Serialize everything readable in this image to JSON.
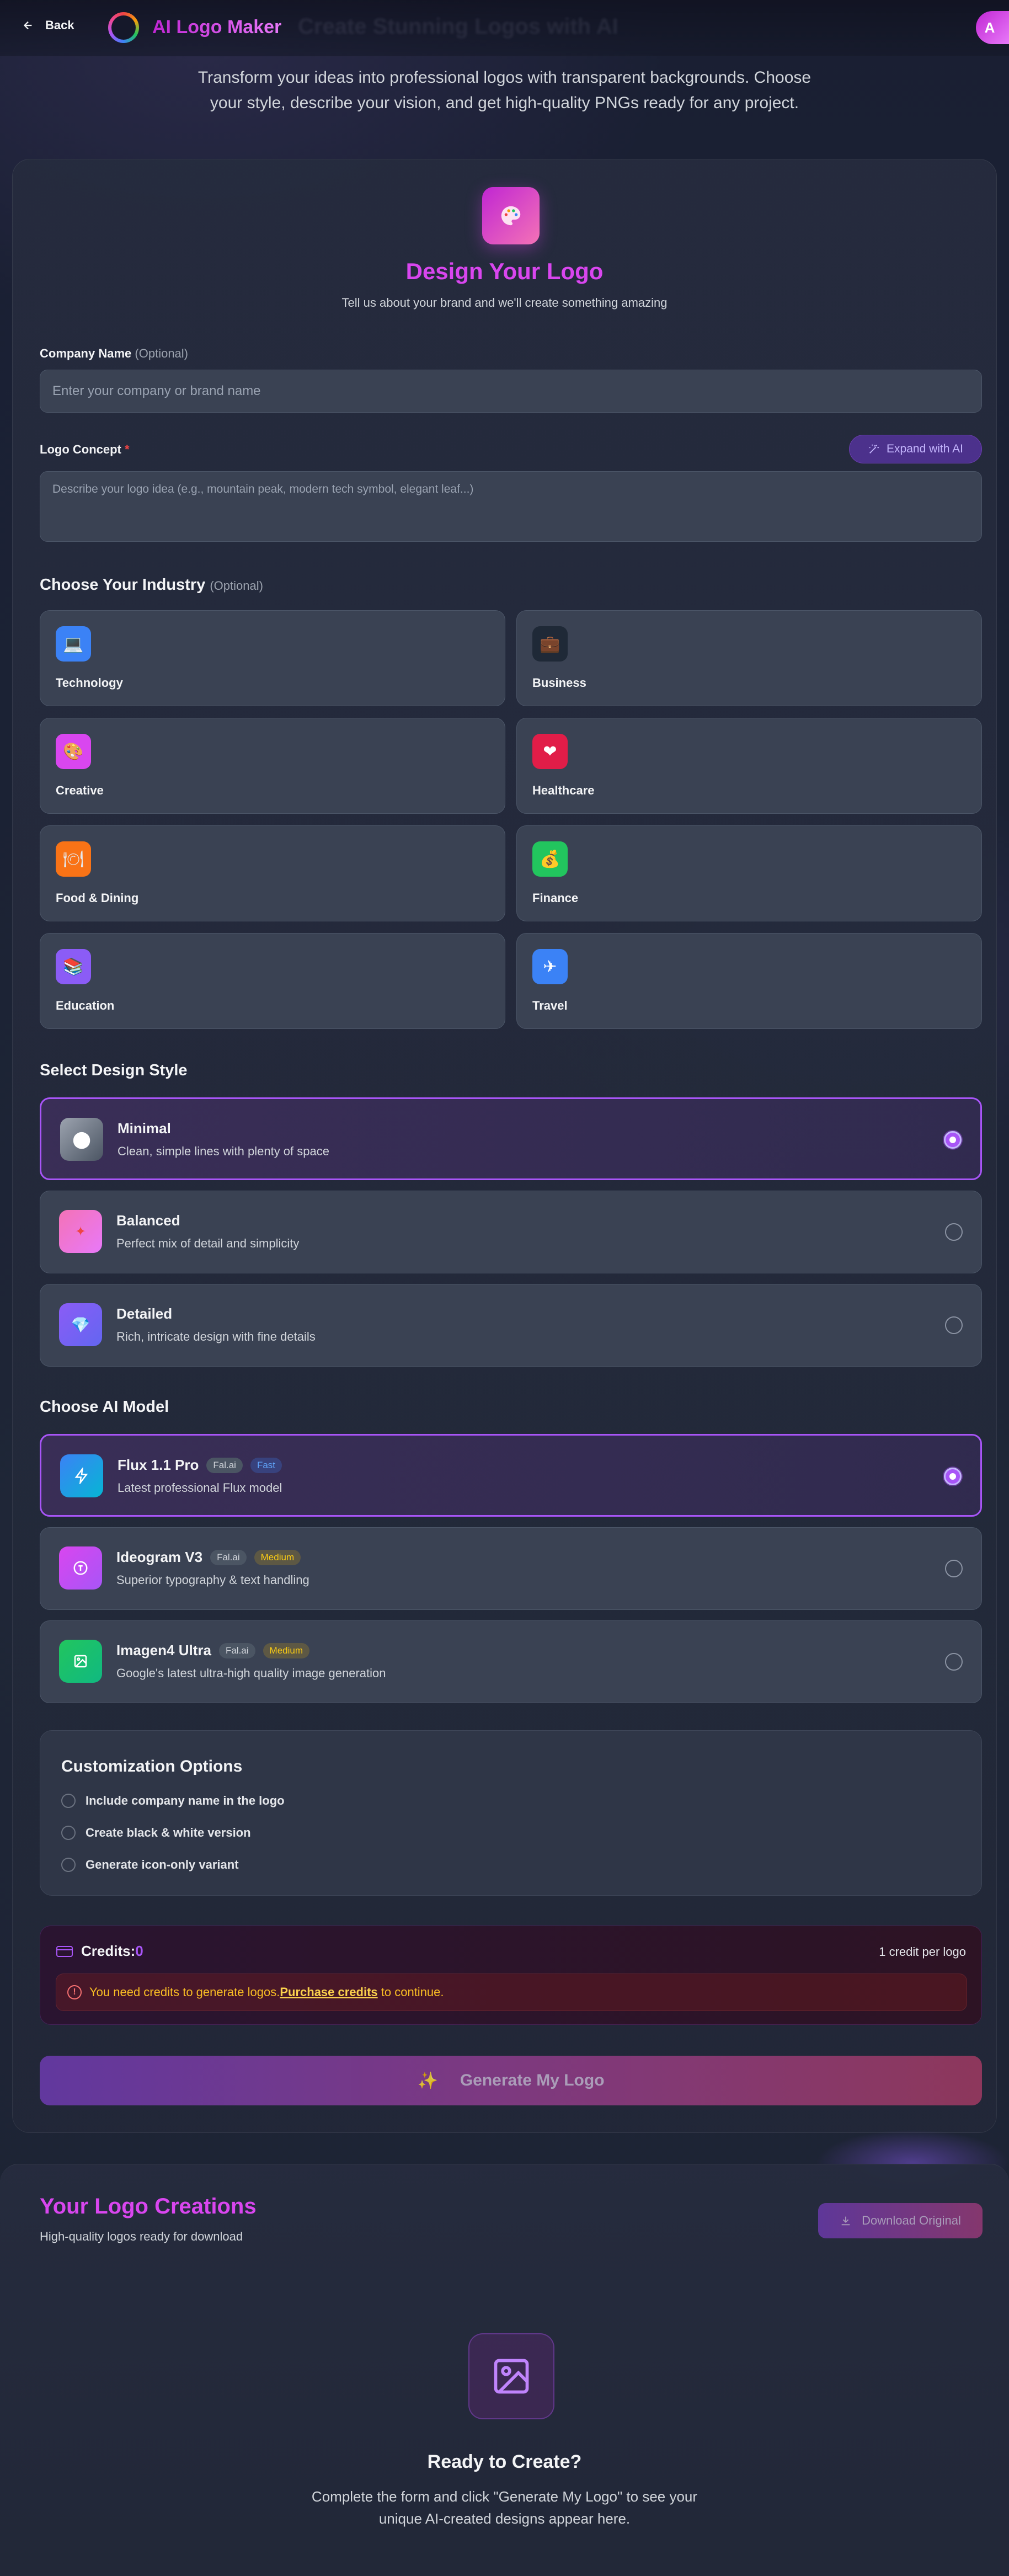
{
  "header": {
    "back_label": "Back",
    "brand": "AI Logo Maker",
    "ghost_title": "Create Stunning Logos with AI",
    "avatar_initial": "A"
  },
  "intro": {
    "line1": "Transform your ideas into professional logos with transparent backgrounds. Choose",
    "line2": "your style, describe your vision, and get high-quality PNGs ready for any project."
  },
  "design": {
    "title": "Design Your Logo",
    "subtitle": "Tell us about your brand and we'll create something amazing"
  },
  "form": {
    "company_label": "Company Name",
    "company_optional": "(Optional)",
    "company_placeholder": "Enter your company or brand name",
    "concept_label": "Logo Concept",
    "concept_required": "*",
    "concept_placeholder": "Describe your logo idea (e.g., mountain peak, modern tech symbol, elegant leaf...)",
    "expand_label": "Expand with AI"
  },
  "industry": {
    "title": "Choose Your Industry",
    "optional": "(Optional)",
    "items": [
      {
        "name": "Technology",
        "icon": "laptop-icon",
        "glyph": "💻",
        "color": "#3b82f6"
      },
      {
        "name": "Business",
        "icon": "briefcase-icon",
        "glyph": "💼",
        "color": "#1f2937"
      },
      {
        "name": "Creative",
        "icon": "palette-icon",
        "glyph": "🎨",
        "color": "#d946ef"
      },
      {
        "name": "Healthcare",
        "icon": "heart-icon",
        "glyph": "❤",
        "color": "#e11d48"
      },
      {
        "name": "Food & Dining",
        "icon": "plate-icon",
        "glyph": "🍽",
        "color": "#f97316"
      },
      {
        "name": "Finance",
        "icon": "moneybag-icon",
        "glyph": "💰",
        "color": "#22c55e"
      },
      {
        "name": "Education",
        "icon": "books-icon",
        "glyph": "📚",
        "color": "#8b5cf6"
      },
      {
        "name": "Travel",
        "icon": "airplane-icon",
        "glyph": "✈",
        "color": "#3b82f6"
      }
    ]
  },
  "style": {
    "title": "Select Design Style",
    "options": [
      {
        "name": "Minimal",
        "desc": "Clean, simple lines with plenty of space",
        "icon": "circle-icon",
        "glyph": "⬤",
        "selected": true
      },
      {
        "name": "Balanced",
        "desc": "Perfect mix of detail and simplicity",
        "icon": "star-icon",
        "glyph": "✦",
        "selected": false
      },
      {
        "name": "Detailed",
        "desc": "Rich, intricate design with fine details",
        "icon": "gem-icon",
        "glyph": "💎",
        "selected": false
      }
    ]
  },
  "model": {
    "title": "Choose AI Model",
    "options": [
      {
        "name": "Flux 1.1 Pro",
        "provider": "Fal.ai",
        "speed": "Fast",
        "desc": "Latest professional Flux model",
        "icon": "bolt-icon",
        "selected": true
      },
      {
        "name": "Ideogram V3",
        "provider": "Fal.ai",
        "speed": "Medium",
        "desc": "Superior typography & text handling",
        "icon": "type-icon",
        "selected": false
      },
      {
        "name": "Imagen4 Ultra",
        "provider": "Fal.ai",
        "speed": "Medium",
        "desc": "Google's latest ultra-high quality image generation",
        "icon": "image-icon",
        "selected": false
      }
    ]
  },
  "customization": {
    "title": "Customization Options",
    "options": [
      "Include company name in the logo",
      "Create black & white version",
      "Generate icon-only variant"
    ]
  },
  "credits": {
    "label": "Credits:",
    "count": "0",
    "per_logo": "1 credit per logo",
    "warning_pre": "You need credits to generate logos.",
    "warning_link": "Purchase credits",
    "warning_post": " to continue."
  },
  "generate": {
    "label": "Generate My Logo",
    "glyph": "✨"
  },
  "creations": {
    "title": "Your Logo Creations",
    "subtitle": "High-quality logos ready for download",
    "download_label": "Download Original",
    "ready_title": "Ready to Create?",
    "ready_line1": "Complete the form and click \"Generate My Logo\" to see your",
    "ready_line2": "unique AI-created designs appear here."
  },
  "colors": {
    "accent": "#d946ef",
    "selected_border": "#a855f7",
    "background": "#1c2233"
  }
}
